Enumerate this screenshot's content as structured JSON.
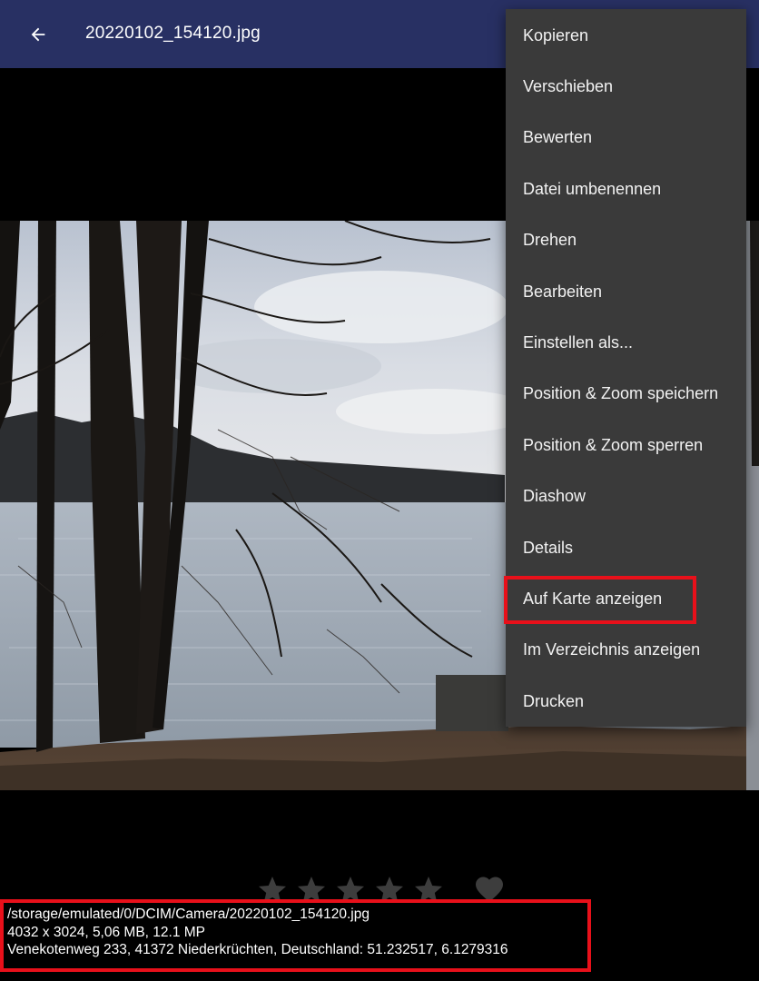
{
  "appbar": {
    "title": "20220102_154120.jpg",
    "background": "#283063",
    "back_icon": "arrow-left-icon"
  },
  "menu": {
    "items": [
      {
        "label": "Kopieren"
      },
      {
        "label": "Verschieben"
      },
      {
        "label": "Bewerten"
      },
      {
        "label": "Datei umbenennen"
      },
      {
        "label": "Drehen"
      },
      {
        "label": "Bearbeiten"
      },
      {
        "label": "Einstellen als..."
      },
      {
        "label": "Position & Zoom speichern"
      },
      {
        "label": "Position & Zoom sperren"
      },
      {
        "label": "Diashow"
      },
      {
        "label": "Details"
      },
      {
        "label": "Auf Karte anzeigen",
        "highlighted": true
      },
      {
        "label": "Im Verzeichnis anzeigen"
      },
      {
        "label": "Drucken"
      }
    ],
    "background": "#3a3a3a"
  },
  "rating": {
    "stars": 5,
    "filled": 0,
    "star_icon": "star-icon",
    "favorite_icon": "heart-icon"
  },
  "info": {
    "path": "/storage/emulated/0/DCIM/Camera/20220102_154120.jpg",
    "dimensions": "4032 x 3024, 5,06 MB, 12.1 MP",
    "location": "Venekotenweg 233, 41372 Niederkrüchten, Deutschland: 51.232517, 6.1279316"
  },
  "highlight_color": "#e8101a"
}
